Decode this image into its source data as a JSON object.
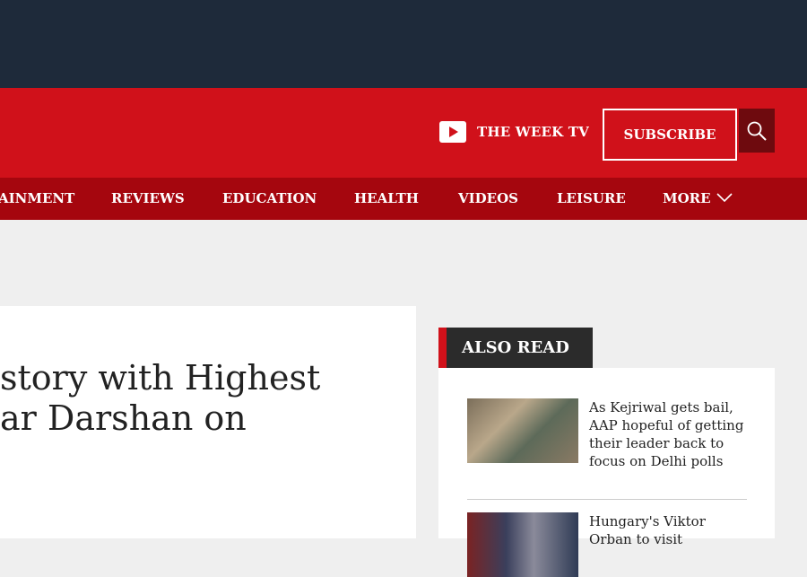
{
  "header": {
    "week_tv_label": "THE WEEK TV",
    "subscribe_label": "SUBSCRIBE"
  },
  "nav": {
    "items": [
      {
        "label": "AINMENT"
      },
      {
        "label": "REVIEWS"
      },
      {
        "label": "EDUCATION"
      },
      {
        "label": "HEALTH"
      },
      {
        "label": "VIDEOS"
      },
      {
        "label": "LEISURE"
      },
      {
        "label": "MORE"
      }
    ]
  },
  "article": {
    "headline_line1": "story with Highest",
    "headline_line2": "ar Darshan on"
  },
  "also_read": {
    "heading": "ALSO READ",
    "stories": [
      {
        "title": "As Kejriwal gets bail, AAP hopeful of getting their leader back to focus on Delhi polls"
      },
      {
        "title": "Hungary's Viktor Orban to visit"
      }
    ]
  },
  "colors": {
    "top_bar": "#1e2a3a",
    "brand_red": "#d0111a",
    "nav_red": "#a5060e",
    "search_bg": "#6e0a0e"
  }
}
